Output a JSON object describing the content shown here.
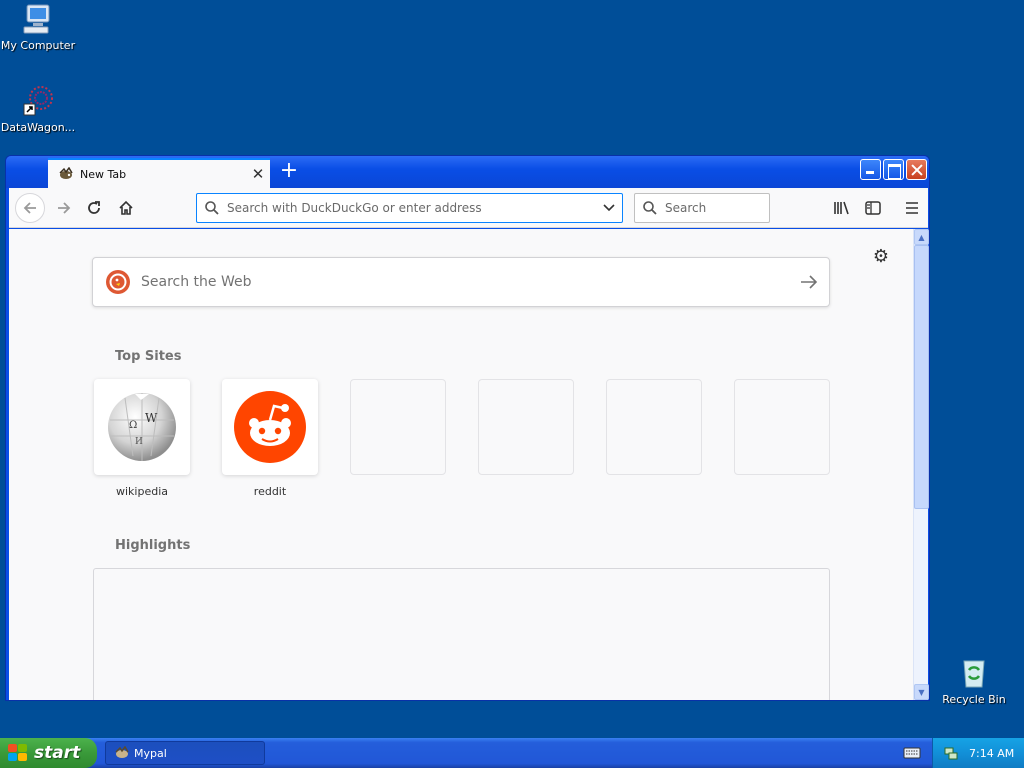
{
  "desktop": {
    "icons": [
      {
        "label": "My Computer"
      },
      {
        "label": "DataWagon..."
      },
      {
        "label": "Recycle Bin"
      }
    ]
  },
  "browser": {
    "tab": {
      "title": "New Tab"
    },
    "url_placeholder": "Search with DuckDuckGo or enter address",
    "search_placeholder": "Search",
    "newtab": {
      "web_search_placeholder": "Search the Web",
      "top_sites_title": "Top Sites",
      "top_sites": [
        {
          "label": "wikipedia"
        },
        {
          "label": "reddit"
        },
        {
          "label": ""
        },
        {
          "label": ""
        },
        {
          "label": ""
        },
        {
          "label": ""
        }
      ],
      "highlights_title": "Highlights"
    }
  },
  "taskbar": {
    "start_label": "start",
    "task_label": "Mypal",
    "clock": "7:14 AM"
  },
  "colors": {
    "desktop": "#004e98",
    "titlebar": "#0a4ee6",
    "reddit": "#ff4500",
    "tab_accent": "#0a84ff"
  }
}
